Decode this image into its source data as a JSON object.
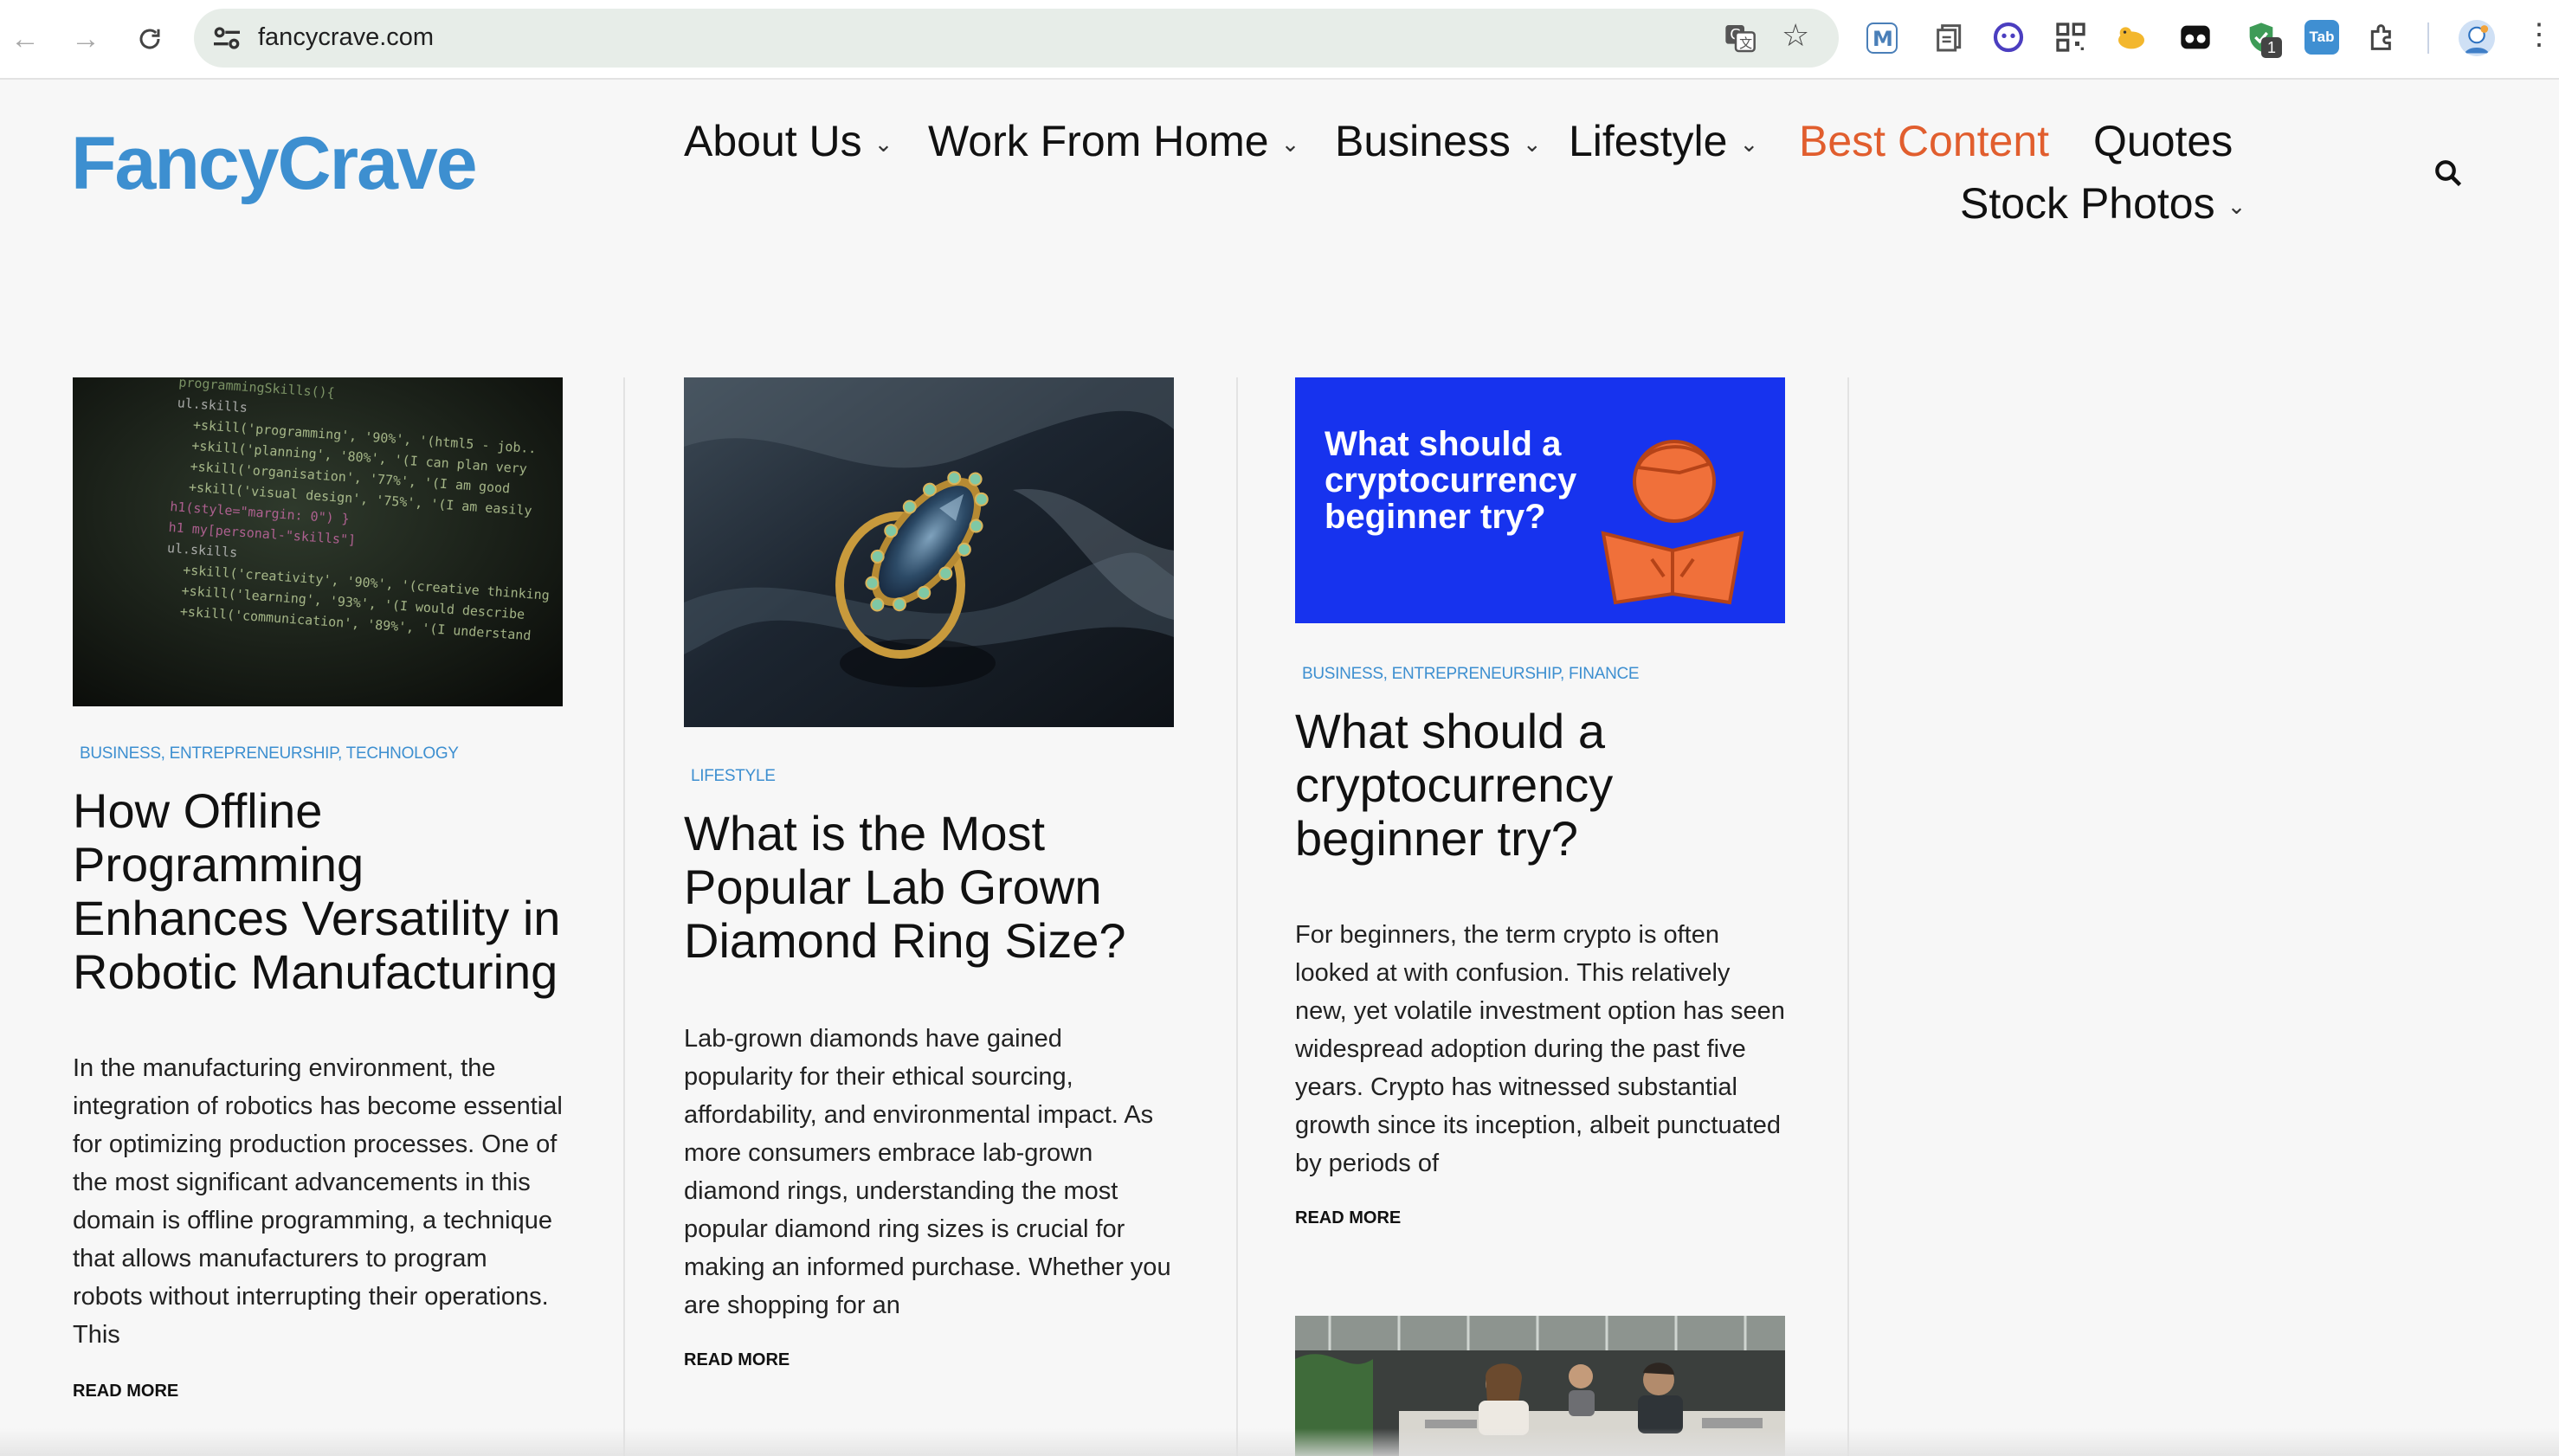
{
  "browser": {
    "url": "fancycrave.com",
    "extension_badge": "1",
    "extension_tab_label": "Tab"
  },
  "site": {
    "logo": "FancyCrave",
    "accent_color": "#3d8fd0",
    "active_color": "#e15e2e",
    "menu": [
      {
        "label": "About Us",
        "chevron": true
      },
      {
        "label": "Work From Home",
        "chevron": true
      },
      {
        "label": "Business",
        "chevron": true
      },
      {
        "label": "Lifestyle",
        "chevron": true
      },
      {
        "label": "Best Content",
        "chevron": false,
        "active": true
      },
      {
        "label": "Quotes",
        "chevron": false
      },
      {
        "label": "Stock Photos",
        "chevron": true
      }
    ]
  },
  "posts": [
    {
      "categories": "BUSINESS, ENTREPRENEURSHIP, TECHNOLOGY",
      "title": "How Offline Programming Enhances Versatility in Robotic Manufacturing",
      "excerpt": "In the manufacturing environment, the integration of robotics has become essential for optimizing production processes. One of the most significant advancements in this domain is offline programming, a technique that allows manufacturers to program robots without interrupting their operations. This",
      "read_more": "READ MORE",
      "image": "code-screen-image"
    },
    {
      "categories": "LIFESTYLE",
      "title": "What is the Most Popular Lab Grown Diamond Ring Size?",
      "excerpt": "Lab-grown diamonds have gained popularity for their ethical sourcing, affordability, and environmental impact. As more consumers embrace lab-grown diamond rings, understanding the most popular diamond ring sizes is crucial for making an informed purchase. Whether you are shopping for an",
      "read_more": "READ MORE",
      "image": "diamond-ring-image"
    },
    {
      "categories": "BUSINESS, ENTREPRENEURSHIP, FINANCE",
      "title": "What should a cryptocurrency beginner try?",
      "excerpt": "For beginners, the term crypto is often looked at with confusion. This relatively new, yet volatile investment option has seen widespread adoption during the past five years. Crypto has witnessed substantial growth since its inception, albeit punctuated by periods of",
      "read_more": "READ MORE",
      "image": "crypto-beginner-banner",
      "image_text": "What should a cryptocurrency beginner try?"
    }
  ]
}
